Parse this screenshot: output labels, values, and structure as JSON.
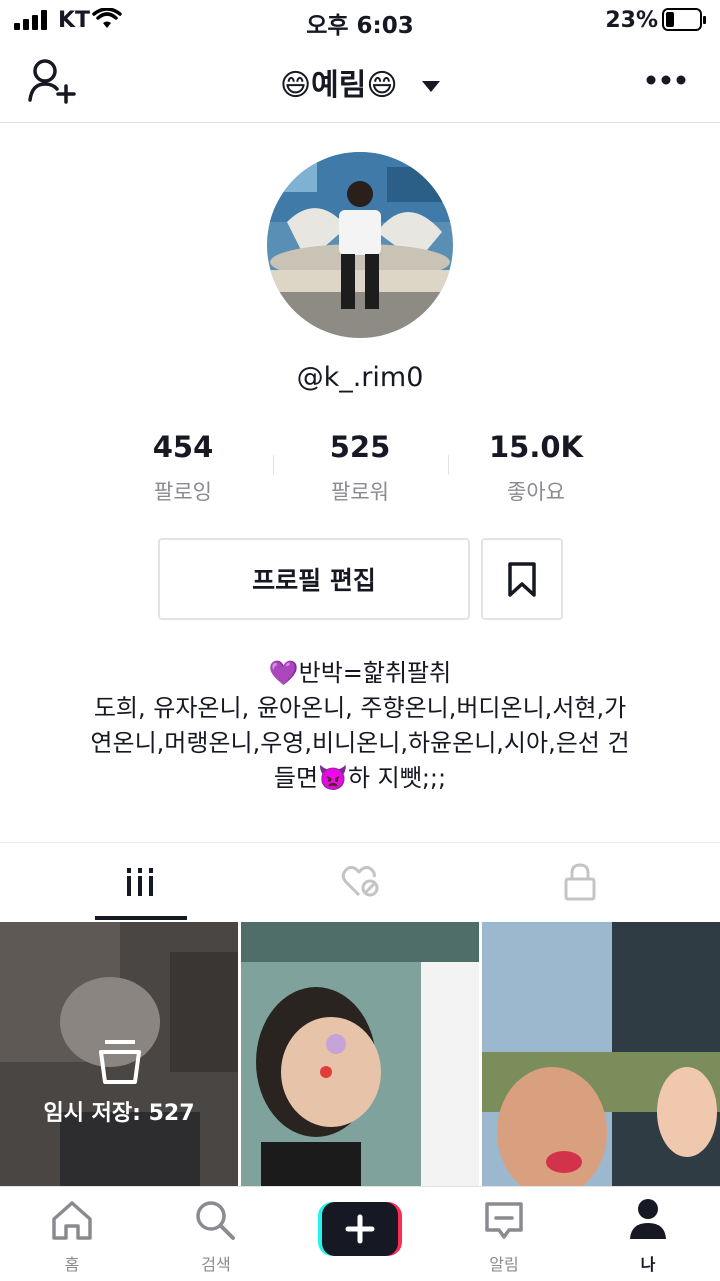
{
  "status_bar": {
    "carrier": "KT",
    "time": "오후 6:03",
    "battery": "23%"
  },
  "header": {
    "title": "😄예림😄"
  },
  "profile": {
    "username": "@k_.rim0",
    "stats": [
      {
        "value": "454",
        "label": "팔로잉"
      },
      {
        "value": "525",
        "label": "팔로워"
      },
      {
        "value": "15.0K",
        "label": "좋아요"
      }
    ],
    "edit_button": "프로필 편집",
    "bio": "💜반박=핥취팔취\n도희, 유자온니, 윤아온니, 주향온니,버디온니,서현,가\n연온니,머랭온니,우영,비니온니,하윤온니,시아,은선 건\n들면👿하 지뺏;;;"
  },
  "videos": {
    "draft_label": "임시 저장: 527"
  },
  "bottom_nav": {
    "items": [
      {
        "label": "홈",
        "icon": "home-icon"
      },
      {
        "label": "검색",
        "icon": "search-icon"
      },
      {
        "label": "",
        "icon": "create-icon"
      },
      {
        "label": "알림",
        "icon": "inbox-icon"
      },
      {
        "label": "나",
        "icon": "profile-icon"
      }
    ]
  },
  "colors": {
    "accent_cyan": "#25f4ee",
    "accent_red": "#fe2c55",
    "text": "#161823",
    "muted": "#8a8b91"
  }
}
